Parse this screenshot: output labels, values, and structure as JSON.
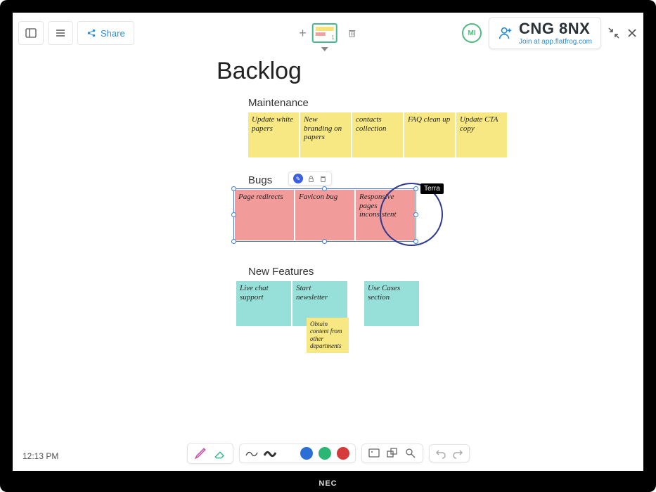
{
  "topbar": {
    "share_label": "Share",
    "page_number": "1",
    "avatar_initials": "MI"
  },
  "room": {
    "code": "CNG 8NX",
    "join_text": "Join at app.flatfrog.com"
  },
  "board": {
    "title": "Backlog",
    "sections": {
      "maintenance": {
        "label": "Maintenance",
        "notes": [
          "Update white papers",
          "New branding on papers",
          "contacts collection",
          "FAQ clean up",
          "Update CTA copy"
        ]
      },
      "bugs": {
        "label": "Bugs",
        "notes": [
          "Page redirects",
          "Favicon bug",
          "Responsive pages inconsistent"
        ],
        "cursor_label": "Terra"
      },
      "features": {
        "label": "New Features",
        "notes": [
          "Live chat support",
          "Start newsletter",
          "Use Cases section"
        ],
        "subnote": "Obtain content from other departments"
      }
    }
  },
  "toolbar": {
    "colors": [
      "#333333",
      "#2b6fd6",
      "#2bb673",
      "#d63a3a"
    ]
  },
  "clock": "12:13 PM",
  "monitor_brand": "NEC"
}
